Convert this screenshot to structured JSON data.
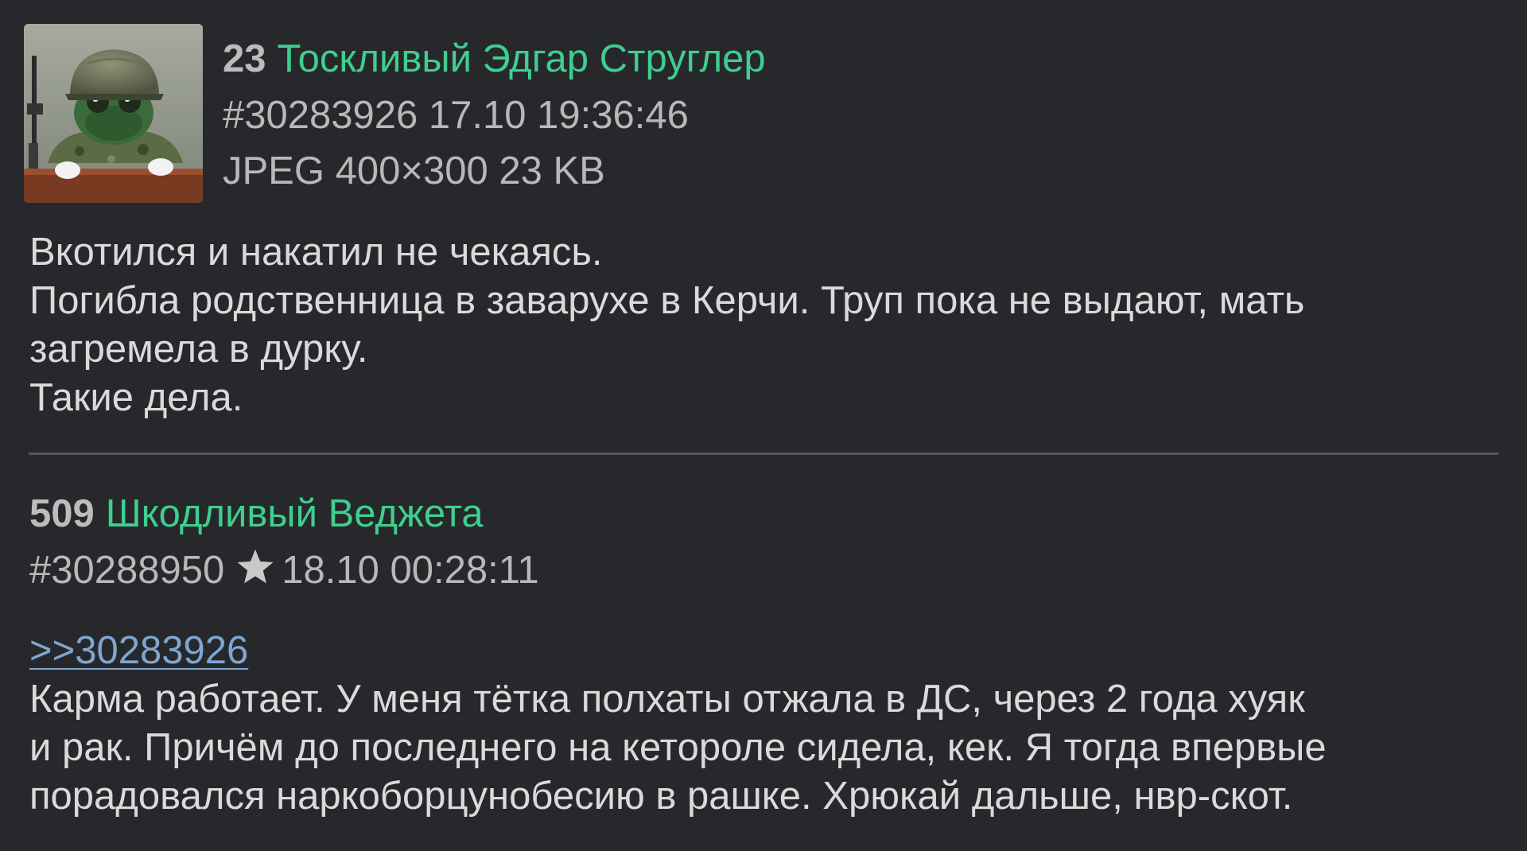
{
  "posts": [
    {
      "number": "23",
      "name": "Тоскливый Эдгар Струглер",
      "id": "#30283926",
      "datetime": "17.10 19:36:46",
      "file_info": "JPEG 400×300 23 KB",
      "has_thumbnail": true,
      "lines": [
        "Вкотился и накатил не чекаясь.",
        "Погибла родственница в заварухе в Керчи. Труп пока не выдают, мать",
        "загремела в дурку.",
        "Такие дела."
      ]
    },
    {
      "number": "509",
      "name": "Шкодливый Веджета",
      "id": "#30288950",
      "datetime": "18.10 00:28:11",
      "starred": true,
      "reply_link": ">>30283926",
      "lines": [
        "Карма работает. У меня тётка полхаты отжала в ДС, через 2 года хуяк",
        "и рак. Причём до последнего на кетороле сидела, кек. Я тогда впервые",
        "порадовался наркоборцунобесию в рашке. Хрюкай дальше, нвр-скот."
      ]
    }
  ],
  "icons": {
    "star": "star-icon"
  },
  "colors": {
    "background": "#27282c",
    "name": "#3ecf8e",
    "link": "#7fa6cf",
    "meta": "#b8b8b8",
    "text": "#dadada",
    "divider": "#55565b"
  }
}
